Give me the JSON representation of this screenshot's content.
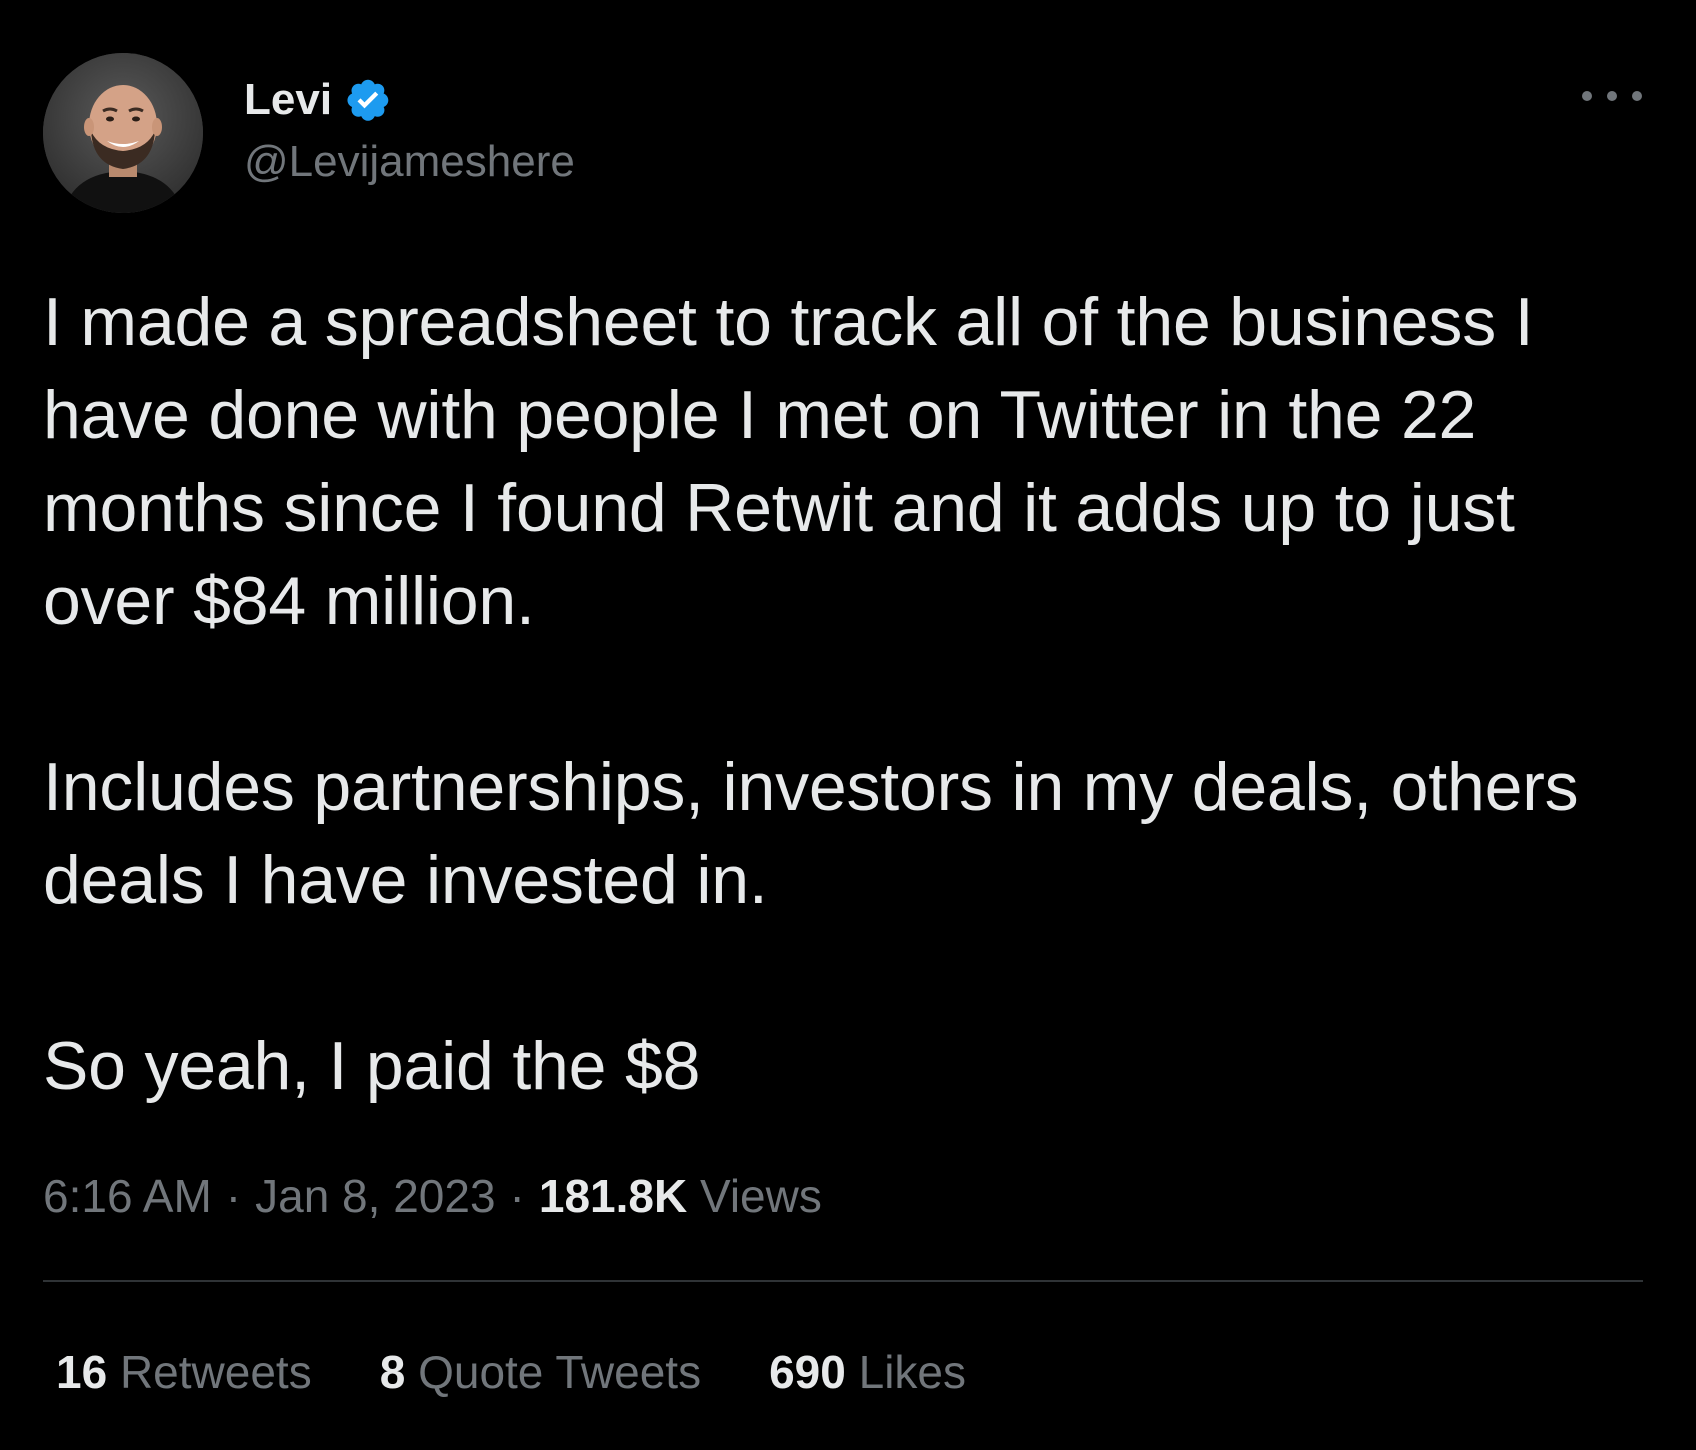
{
  "author": {
    "name": "Levi",
    "handle": "@Levijameshere",
    "verified": true,
    "verified_color": "#1d9bf0",
    "avatar_icon": "avatar-photo"
  },
  "tweet": {
    "paragraphs": [
      "I made a spreadsheet to track all of the business I have done with people I met on Twitter in the 22 months since I found Retwit and it adds up to just over $84 million.",
      "Includes partnerships, investors in my deals, others deals I have invested in.",
      "So yeah, I paid the $8"
    ],
    "time": "6:16 AM",
    "separator": "·",
    "date": "Jan 8, 2023",
    "views_count": "181.8K",
    "views_label": "Views"
  },
  "stats": {
    "retweets": {
      "count": "16",
      "label": "Retweets"
    },
    "quote_tweets": {
      "count": "8",
      "label": "Quote Tweets"
    },
    "likes": {
      "count": "690",
      "label": "Likes"
    }
  },
  "more_icon": "more-horizontal-icon",
  "colors": {
    "background": "#000000",
    "text_primary": "#e7e9ea",
    "text_secondary": "#71767b",
    "divider": "#2f3336",
    "accent": "#1d9bf0"
  }
}
